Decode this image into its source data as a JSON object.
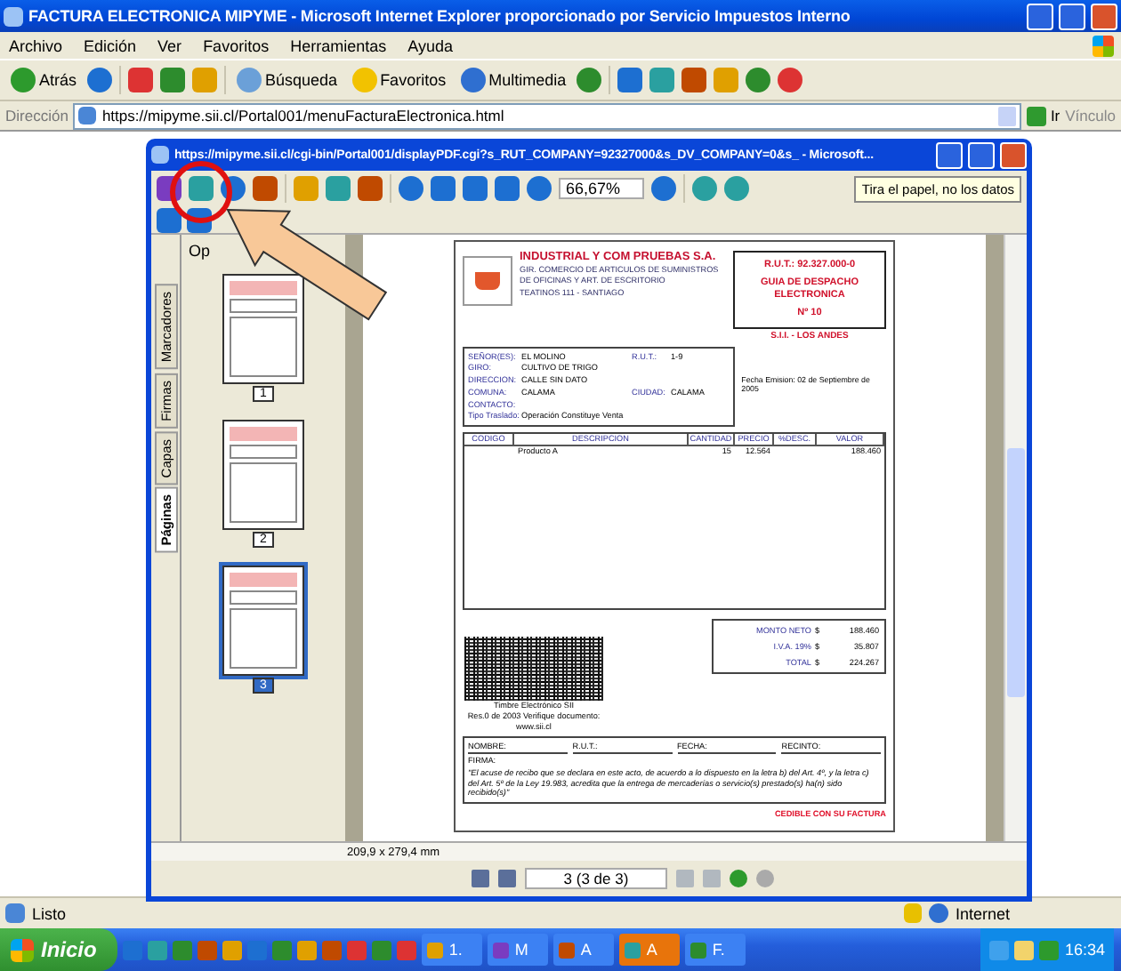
{
  "browser": {
    "title": "FACTURA ELECTRONICA MIPYME - Microsoft Internet Explorer proporcionado por Servicio Impuestos Interno",
    "menu": [
      "Archivo",
      "Edición",
      "Ver",
      "Favoritos",
      "Herramientas",
      "Ayuda"
    ],
    "toolbar": {
      "back": "Atrás",
      "search": "Búsqueda",
      "favorites": "Favoritos",
      "media": "Multimedia"
    },
    "address": {
      "label": "Dirección",
      "url": "https://mipyme.sii.cl/Portal001/menuFacturaElectronica.html",
      "go": "Ir",
      "links": "Vínculo"
    },
    "status": {
      "text": "Listo",
      "zone": "Internet"
    }
  },
  "viewer": {
    "title": "https://mipyme.sii.cl/cgi-bin/Portal001/displayPDF.cgi?s_RUT_COMPANY=92327000&s_DV_COMPANY=0&s_ - Microsoft...",
    "zoom": "66,67%",
    "tooltip": "Tira el papel, no los datos",
    "panel_title": "Op",
    "side_tabs": [
      {
        "label": "Marcadores",
        "selected": false
      },
      {
        "label": "Firmas",
        "selected": false
      },
      {
        "label": "Capas",
        "selected": false
      },
      {
        "label": "Páginas",
        "selected": true
      }
    ],
    "thumbnails": [
      {
        "label": "1",
        "selected": false
      },
      {
        "label": "2",
        "selected": false
      },
      {
        "label": "3",
        "selected": true
      }
    ],
    "page_size": "209,9 x 279,4 mm",
    "page_field": "3 (3 de 3)"
  },
  "document": {
    "company": "INDUSTRIAL Y COM PRUEBAS S.A.",
    "business": "GIR. COMERCIO DE ARTICULOS DE SUMINISTROS DE OFICINAS Y ART. DE ESCRITORIO",
    "address": "TEATINOS 111 - SANTIAGO",
    "rut": "R.U.T.: 92.327.000-0",
    "doc_type": "GUIA DE DESPACHO ELECTRONICA",
    "number": "Nº 10",
    "office": "S.I.I. - LOS ANDES",
    "issue_date": "Fecha Emision: 02 de Septiembre de 2005",
    "receiver": [
      {
        "label": "SEÑOR(ES):",
        "value": "EL MOLINO",
        "label2": "R.U.T.:",
        "value2": "1-9"
      },
      {
        "label": "GIRO:",
        "value": "CULTIVO DE TRIGO"
      },
      {
        "label": "DIRECCION:",
        "value": "CALLE SIN DATO"
      },
      {
        "label": "COMUNA:",
        "value": "CALAMA",
        "label2": "CIUDAD:",
        "value2": "CALAMA"
      },
      {
        "label": "CONTACTO:"
      },
      {
        "label": "Tipo Traslado:",
        "value": "Operación Constituye Venta"
      }
    ],
    "columns": [
      "CODIGO",
      "DESCRIPCION",
      "CANTIDAD",
      "PRECIO",
      "%DESC.",
      "VALOR"
    ],
    "rows": [
      [
        "",
        "Producto A",
        "15",
        "12.564",
        "",
        "188.460"
      ]
    ],
    "totals": [
      {
        "label": "MONTO NETO",
        "currency": "$",
        "value": "188.460"
      },
      {
        "label": "I.V.A. 19%",
        "currency": "$",
        "value": "35.807"
      },
      {
        "label": "TOTAL",
        "currency": "$",
        "value": "224.267"
      }
    ],
    "stamp": [
      "Timbre Electrónico SII",
      "Res.0 de 2003 Verifique documento:",
      "www.sii.cl"
    ],
    "receipt_fields": [
      "NOMBRE:",
      "R.U.T.:",
      "FECHA:",
      "RECINTO:"
    ],
    "signature": "FIRMA:",
    "receipt_text": "\"El acuse de recibo que se declara en este acto, de acuerdo a lo dispuesto en la letra b) del Art. 4º, y la letra c) del Art. 5º de la Ley 19.983, acredita que la entrega de mercaderías o servicio(s) prestado(s) ha(n) sido recibido(s)\"",
    "copy_note": "CEDIBLE CON SU FACTURA"
  },
  "taskbar": {
    "start": "Inicio",
    "tasks": [
      {
        "label": "1.",
        "selected": false
      },
      {
        "label": "M",
        "selected": false
      },
      {
        "label": "A",
        "selected": false
      },
      {
        "label": "A",
        "selected": true
      },
      {
        "label": "F.",
        "selected": false
      }
    ],
    "clock": "16:34"
  }
}
